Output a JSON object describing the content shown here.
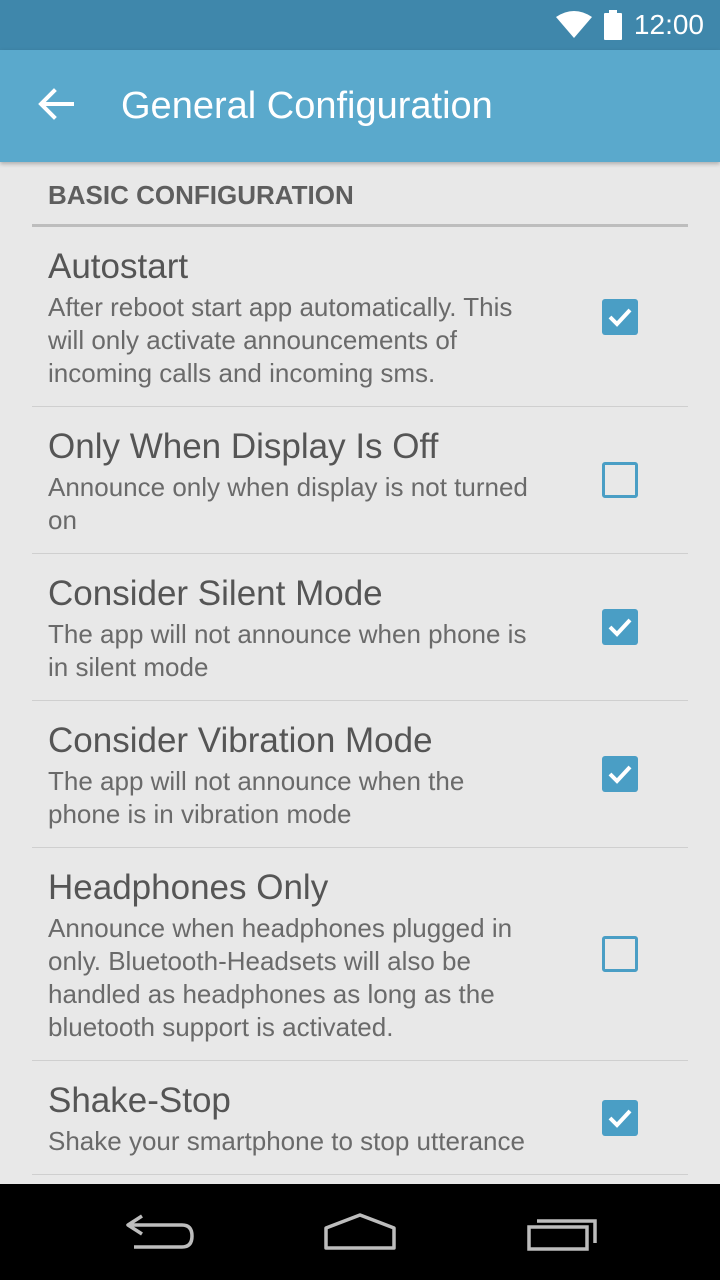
{
  "status_bar": {
    "time": "12:00"
  },
  "app_bar": {
    "title": "General Configuration"
  },
  "section": {
    "header": "BASIC CONFIGURATION"
  },
  "preferences": [
    {
      "title": "Autostart",
      "summary": "After reboot start app automatically. This will only activate announcements of incoming calls and incoming sms.",
      "checked": true
    },
    {
      "title": "Only When Display Is Off",
      "summary": "Announce only when display is not turned on",
      "checked": false
    },
    {
      "title": "Consider Silent Mode",
      "summary": "The app will not announce when phone is in silent mode",
      "checked": true
    },
    {
      "title": "Consider Vibration Mode",
      "summary": "The app will not announce when the phone is in vibration mode",
      "checked": true
    },
    {
      "title": "Headphones Only",
      "summary": "Announce when headphones plugged in only. Bluetooth-Headsets will also be handled as headphones as long as the bluetooth support is activated.",
      "checked": false
    },
    {
      "title": "Shake-Stop",
      "summary": "Shake your smartphone to stop utterance",
      "checked": true
    }
  ],
  "colors": {
    "accent": "#4a9ec5",
    "app_bar": "#5aa9cc",
    "status_bar": "#3f87ab"
  },
  "icons": [
    "wifi-icon",
    "battery-icon",
    "back-arrow-icon",
    "back-nav-icon",
    "home-nav-icon",
    "recents-nav-icon",
    "checkmark-icon"
  ]
}
